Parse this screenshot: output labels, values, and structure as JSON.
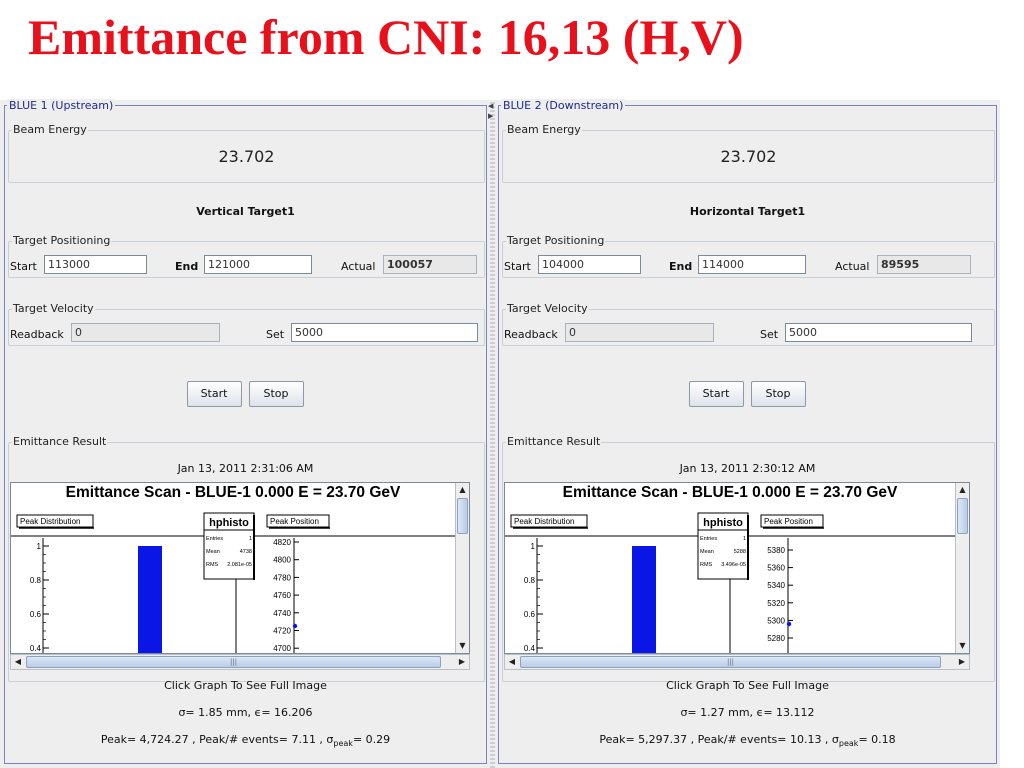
{
  "slide_title": "Emittance from CNI: 16,13 (H,V)",
  "panels": [
    {
      "title": "BLUE 1 (Upstream)",
      "beam_energy_label": "Beam Energy",
      "beam_energy": "23.702",
      "target": "Vertical Target1",
      "positioning_label": "Target Positioning",
      "start_label": "Start",
      "start_value": "113000",
      "end_label": "End",
      "end_value": "121000",
      "actual_label": "Actual",
      "actual_value": "100057",
      "velocity_label": "Target Velocity",
      "readback_label": "Readback",
      "readback_value": "0",
      "set_label": "Set",
      "set_value": "5000",
      "start_button": "Start",
      "stop_button": "Stop",
      "result_label": "Emittance Result",
      "result_date": "Jan 13, 2011 2:31:06 AM",
      "plot": {
        "title": "Emittance Scan - BLUE-1    0.000 E =  23.70 GeV",
        "peak_distribution_label": "Peak Distribution",
        "stats_title": "hphisto",
        "stats": [
          [
            "Entries",
            "1"
          ],
          [
            "Mean",
            "4738"
          ],
          [
            "RMS",
            "2.081e-05"
          ]
        ],
        "peak_position_label": "Peak Position",
        "left_ticks": [
          "1",
          "0.8",
          "0.6",
          "0.4"
        ],
        "right_ticks": [
          "4820",
          "4800",
          "4780",
          "4760",
          "4740",
          "4720",
          "4700"
        ]
      },
      "click_text": "Click Graph To See Full Image",
      "sigma_text": "σ= 1.85 mm, ϵ= 16.206",
      "peak_text": "Peak= 4,724.27 , Peak/# events= 7.11 , σ",
      "peak_sub": "peak",
      "peak_tail": "= 0.29"
    },
    {
      "title": "BLUE 2 (Downstream)",
      "beam_energy_label": "Beam Energy",
      "beam_energy": "23.702",
      "target": "Horizontal Target1",
      "positioning_label": "Target Positioning",
      "start_label": "Start",
      "start_value": "104000",
      "end_label": "End",
      "end_value": "114000",
      "actual_label": "Actual",
      "actual_value": "89595",
      "velocity_label": "Target Velocity",
      "readback_label": "Readback",
      "readback_value": "0",
      "set_label": "Set",
      "set_value": "5000",
      "start_button": "Start",
      "stop_button": "Stop",
      "result_label": "Emittance Result",
      "result_date": "Jan 13, 2011 2:30:12 AM",
      "plot": {
        "title": "Emittance Scan - BLUE-1    0.000 E =  23.70 GeV",
        "peak_distribution_label": "Peak Distribution",
        "stats_title": "hphisto",
        "stats": [
          [
            "Entries",
            "1"
          ],
          [
            "Mean",
            "5288"
          ],
          [
            "RMS",
            "3.496e-05"
          ]
        ],
        "peak_position_label": "Peak Position",
        "left_ticks": [
          "1",
          "0.8",
          "0.6",
          "0.4"
        ],
        "right_ticks": [
          "5380",
          "5360",
          "5340",
          "5320",
          "5300",
          "5280"
        ]
      },
      "click_text": "Click Graph To See Full Image",
      "sigma_text": "σ= 1.27 mm, ϵ= 13.112",
      "peak_text": "Peak= 5,297.37 , Peak/# events= 10.13 , σ",
      "peak_sub": "peak",
      "peak_tail": "= 0.18"
    }
  ],
  "colors": {
    "title_red": "#e8101a",
    "bar_blue": "#0a16e6",
    "panel_border": "#7d7fc9"
  }
}
